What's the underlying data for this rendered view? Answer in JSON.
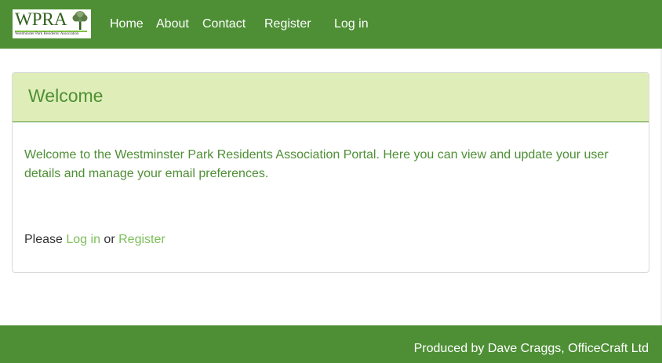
{
  "brand": {
    "logo_text": "WPRA",
    "logo_subtitle": "Westminster Park Residents' Association",
    "logo_icon": "tree-icon"
  },
  "nav": {
    "items": [
      "Home",
      "About",
      "Contact",
      "Register",
      "Log in"
    ]
  },
  "panel": {
    "title": "Welcome",
    "body": "Welcome to the Westminster Park Residents Association Portal. Here you can view and update your user details and manage your email preferences.",
    "prompt_prefix": "Please",
    "login_link": "Log in",
    "prompt_or": "or",
    "register_link": "Register"
  },
  "footer": {
    "text": "Produced by Dave Craggs, OfficeCraft Ltd"
  },
  "colors": {
    "primary": "#4e8f35",
    "heading_bg": "#dfeeb8",
    "link": "#7cbf5a"
  }
}
